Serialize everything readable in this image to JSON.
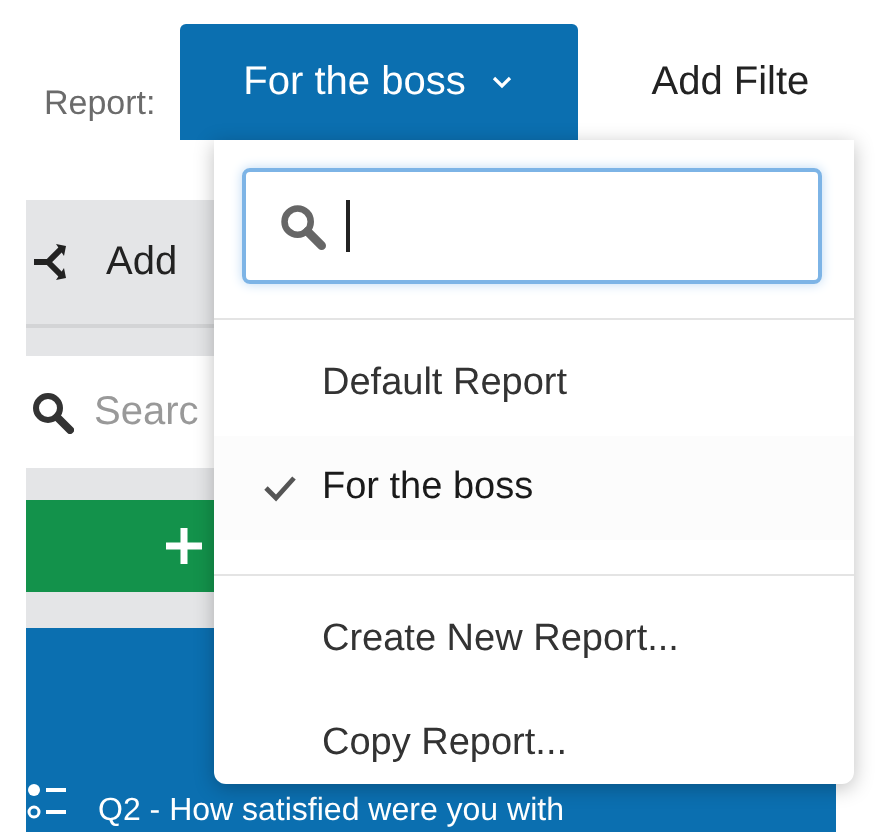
{
  "toolbar": {
    "label": "Report:",
    "report_button": "For the boss",
    "add_filter": "Add Filte"
  },
  "sidebar": {
    "add_label": "Add",
    "search": {
      "placeholder": "Searc"
    },
    "question": "Q2 - How satisfied were you with"
  },
  "dropdown": {
    "sections": [
      [
        {
          "label": "Default Report",
          "selected": false
        },
        {
          "label": "For the boss",
          "selected": true
        }
      ],
      [
        {
          "label": "Create New Report..."
        },
        {
          "label": "Copy Report..."
        }
      ]
    ]
  }
}
